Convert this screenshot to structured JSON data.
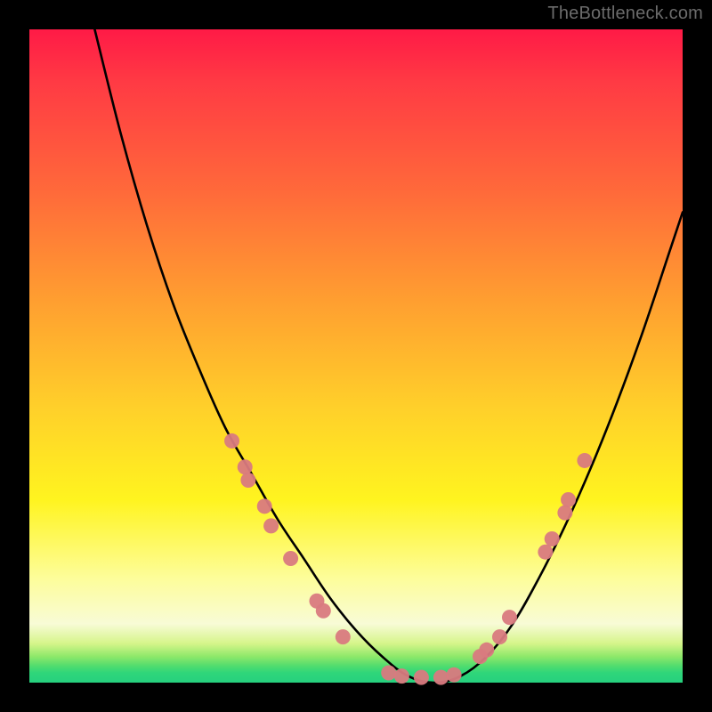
{
  "watermark": "TheBottleneck.com",
  "chart_data": {
    "type": "line",
    "title": "",
    "xlabel": "",
    "ylabel": "",
    "xlim": [
      0,
      100
    ],
    "ylim": [
      0,
      100
    ],
    "series": [
      {
        "name": "bottleneck-curve",
        "x": [
          10,
          14,
          18,
          22,
          26,
          30,
          34,
          38,
          42,
          46,
          50,
          54,
          58,
          62,
          66,
          70,
          74,
          78,
          82,
          86,
          90,
          94,
          98,
          100
        ],
        "y": [
          100,
          84,
          70,
          58,
          48,
          39,
          32,
          25,
          19,
          13,
          8,
          4,
          1,
          0,
          1,
          4,
          9,
          16,
          24,
          33,
          43,
          54,
          66,
          72
        ]
      }
    ],
    "markers": {
      "name": "highlighted-points",
      "color": "#d97a7f",
      "points": [
        {
          "x": 31,
          "y": 37
        },
        {
          "x": 33,
          "y": 33
        },
        {
          "x": 33.5,
          "y": 31
        },
        {
          "x": 36,
          "y": 27
        },
        {
          "x": 37,
          "y": 24
        },
        {
          "x": 40,
          "y": 19
        },
        {
          "x": 44,
          "y": 12.5
        },
        {
          "x": 45,
          "y": 11
        },
        {
          "x": 48,
          "y": 7
        },
        {
          "x": 55,
          "y": 1.5
        },
        {
          "x": 57,
          "y": 1
        },
        {
          "x": 60,
          "y": 0.8
        },
        {
          "x": 63,
          "y": 0.8
        },
        {
          "x": 65,
          "y": 1.2
        },
        {
          "x": 69,
          "y": 4
        },
        {
          "x": 70,
          "y": 5
        },
        {
          "x": 72,
          "y": 7
        },
        {
          "x": 73.5,
          "y": 10
        },
        {
          "x": 79,
          "y": 20
        },
        {
          "x": 80,
          "y": 22
        },
        {
          "x": 82,
          "y": 26
        },
        {
          "x": 82.5,
          "y": 28
        },
        {
          "x": 85,
          "y": 34
        }
      ]
    }
  }
}
